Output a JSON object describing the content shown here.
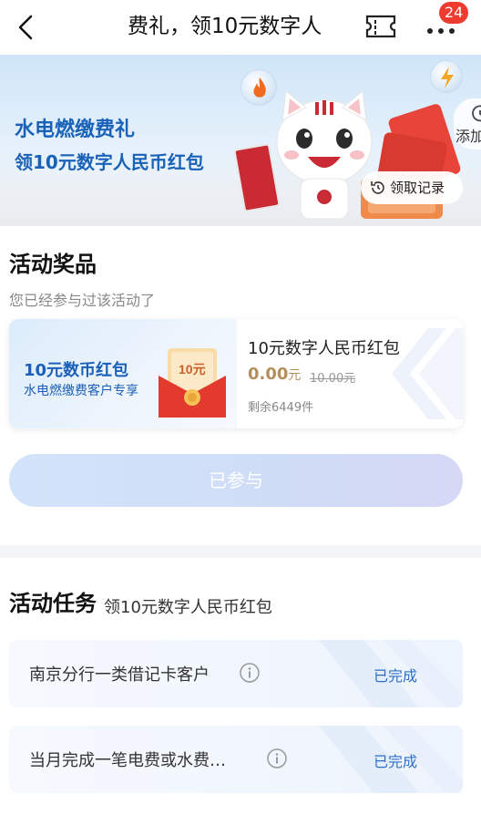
{
  "nav": {
    "title": "费礼，领10元数字人",
    "badge_count": "24",
    "icons": [
      "back-arrow-icon",
      "ticket-icon",
      "more-icon"
    ]
  },
  "banner": {
    "line1": "水电燃缴费礼",
    "line2": "领10元数字人民币红包",
    "add_label": "添加",
    "record_label": "领取记录"
  },
  "prize_section": {
    "title": "活动奖品",
    "joined_note": "您已经参与过该活动了",
    "card": {
      "image_line1": "10元数币红包",
      "image_line2": "水电燃缴费客户专享",
      "envelope_text": "10元",
      "name": "10元数字人民币红包",
      "price": "0.00",
      "price_unit": "元",
      "old_price": "10.00元",
      "stock": "剩余6449件"
    },
    "button_label": "已参与"
  },
  "task_section": {
    "title": "活动任务",
    "subtitle": "领10元数字人民币红包",
    "tasks": [
      {
        "label": "南京分行一类借记卡客户",
        "status": "已完成"
      },
      {
        "label": "当月完成一笔电费或水费…",
        "status": "已完成"
      }
    ]
  },
  "colors": {
    "accent_blue": "#1a62b8",
    "status_blue": "#2d6fc7",
    "price_gold": "#b58f5b",
    "badge_red": "#ee3b2f"
  }
}
